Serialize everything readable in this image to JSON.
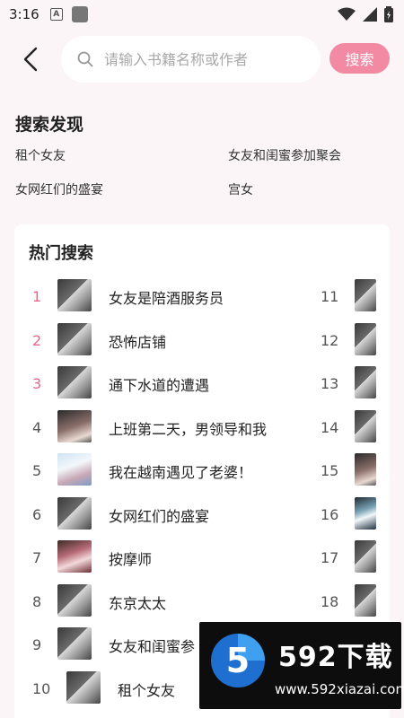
{
  "status_bar": {
    "time": "3:16",
    "a_badge": "A"
  },
  "search": {
    "placeholder": "请输入书籍名称或作者",
    "button_label": "搜索"
  },
  "discover": {
    "title": "搜索发现",
    "items": [
      "租个女友",
      "女友和闺蜜参加聚会",
      "女网红们的盛宴",
      "宫女"
    ]
  },
  "hot": {
    "title": "热门搜索",
    "rows": [
      {
        "rank": "1",
        "title": "女友是陪酒服务员",
        "right_rank": "11"
      },
      {
        "rank": "2",
        "title": "恐怖店铺",
        "right_rank": "12"
      },
      {
        "rank": "3",
        "title": "通下水道的遭遇",
        "right_rank": "13"
      },
      {
        "rank": "4",
        "title": "上班第二天，男领导和我",
        "right_rank": "14"
      },
      {
        "rank": "5",
        "title": "我在越南遇见了老婆！",
        "right_rank": "15"
      },
      {
        "rank": "6",
        "title": "女网红们的盛宴",
        "right_rank": "16"
      },
      {
        "rank": "7",
        "title": "按摩师",
        "right_rank": "17"
      },
      {
        "rank": "8",
        "title": "东京太太",
        "right_rank": "18"
      },
      {
        "rank": "9",
        "title": "女友和闺蜜参",
        "right_rank": ""
      },
      {
        "rank": "10",
        "title": "租个女友",
        "right_rank": ""
      }
    ]
  },
  "watermark": {
    "brand": "592下载",
    "url": "www.592xiazai.com",
    "logo_digit": "5"
  },
  "colors": {
    "accent": "#f28aa3",
    "hot_rank": "#e8668a",
    "background": "#fbf5f7"
  }
}
